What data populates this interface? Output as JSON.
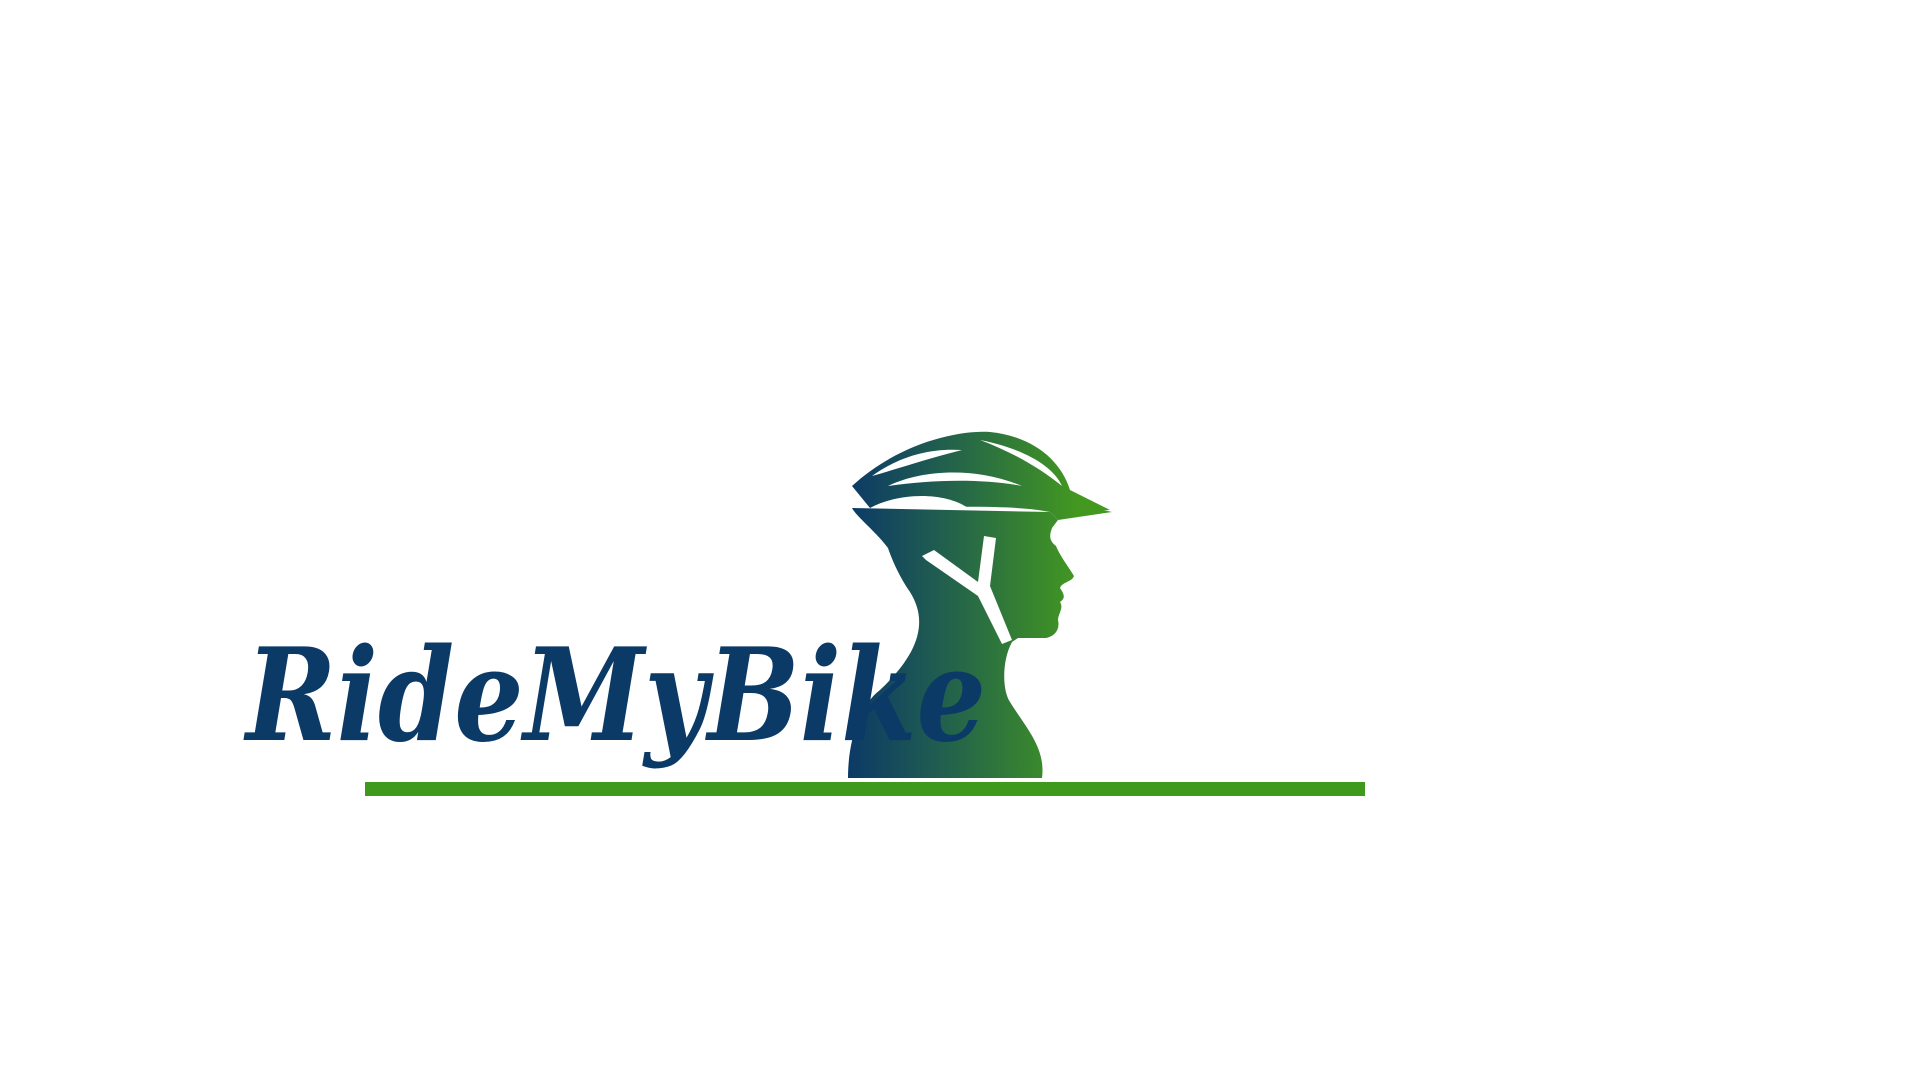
{
  "logo": {
    "wordmark": "RideMyBike",
    "colors": {
      "navy": "#0c3a66",
      "green": "#43991f",
      "underline": "#3f991d",
      "background": "#ffffff",
      "cutout": "#ffffff"
    },
    "icon": "cyclist-helmet-head-icon"
  }
}
